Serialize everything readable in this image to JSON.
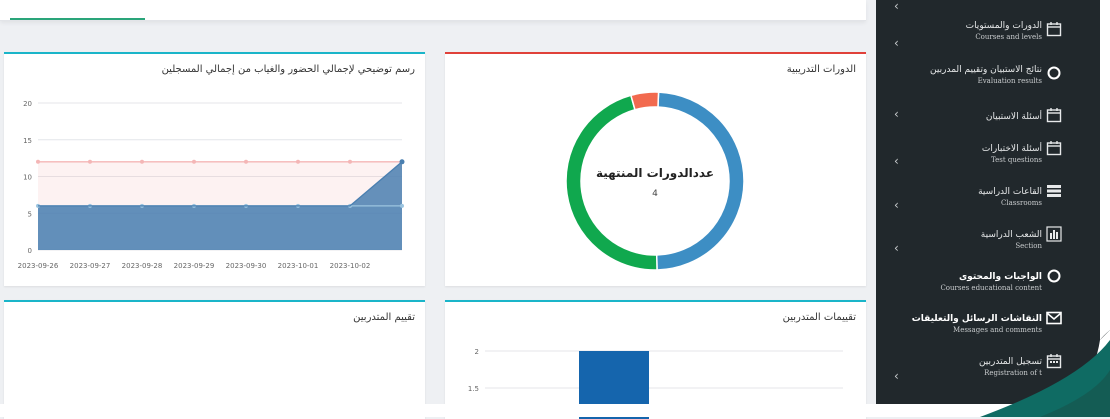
{
  "sidebar": {
    "items": [
      {
        "label": "الدورات والمستويات",
        "sub": "Courses and levels",
        "icon": "calendar-icon"
      },
      {
        "label": "نتائج الاستبيان وتقييم المدربين",
        "sub": "Evaluation results",
        "icon": "circle-icon"
      },
      {
        "label": "أسئلة الاستبيان",
        "sub": "",
        "icon": "calendar-icon"
      },
      {
        "label": "أسئلة الاختبارات",
        "sub": "Test questions",
        "icon": "calendar-icon"
      },
      {
        "label": "القاعات الدراسية",
        "sub": "Classrooms",
        "icon": "classroom-icon"
      },
      {
        "label": "الشعب الدراسية",
        "sub": "Section",
        "icon": "bar-chart-icon"
      },
      {
        "label": "الواجبات والمحتوى",
        "sub": "Courses educational content",
        "icon": "circle-icon"
      },
      {
        "label": "النقاشات الرسائل والتعليقات",
        "sub": "Messages and comments",
        "icon": "envelope-icon"
      },
      {
        "label": "تسجيل المتدربين",
        "sub": "Registration of t",
        "icon": "calendar-icon"
      }
    ]
  },
  "panels": {
    "attendance_title": "رسم توضيحي لإجمالي الحضور والغياب من إجمالي المسجلين",
    "courses_title": "الدورات التدريبية",
    "trainee_eval_title": "تقييم المتدربين",
    "trainee_ratings_title": "تقييمات المتدربين"
  },
  "colors": {
    "sidebar_bg": "#21282c",
    "donut_blue": "#3d8ec4",
    "donut_green": "#10a84e",
    "donut_red": "#f26a4f",
    "bar_blue": "#1565ad",
    "panel_top_teal": "#1ab5c9",
    "panel_top_red": "#e0413a"
  },
  "chart_data": [
    {
      "type": "area",
      "categories": [
        "2023-09-26",
        "2023-09-27",
        "2023-09-28",
        "2023-09-29",
        "2023-09-30",
        "2023-10-01",
        "2023-10-02"
      ],
      "yticks": [
        "0",
        "5",
        "10",
        "15",
        "20"
      ],
      "ylim": [
        0,
        20
      ],
      "series": [
        {
          "values": [
            12,
            12,
            12,
            12,
            12,
            12,
            12,
            12
          ],
          "color": "#f4b6b6"
        },
        {
          "values": [
            6,
            6,
            6,
            6,
            6,
            6,
            6,
            6
          ],
          "color": "#9cc4df"
        },
        {
          "values": [
            6,
            6,
            6,
            6,
            6,
            6,
            6,
            12
          ],
          "color": "#4a7fb0"
        }
      ],
      "grid": true
    },
    {
      "type": "pie",
      "center_title": "عددالدورات المنتهية",
      "center_value": "4",
      "slices": [
        {
          "value": 49,
          "color": "#3d8ec4"
        },
        {
          "value": 46,
          "color": "#10a84e"
        },
        {
          "value": 5,
          "color": "#f26a4f"
        }
      ]
    },
    {
      "type": "bar",
      "yticks": [
        "1.5",
        "2"
      ],
      "values": [
        2
      ],
      "color": "#1565ad"
    }
  ]
}
